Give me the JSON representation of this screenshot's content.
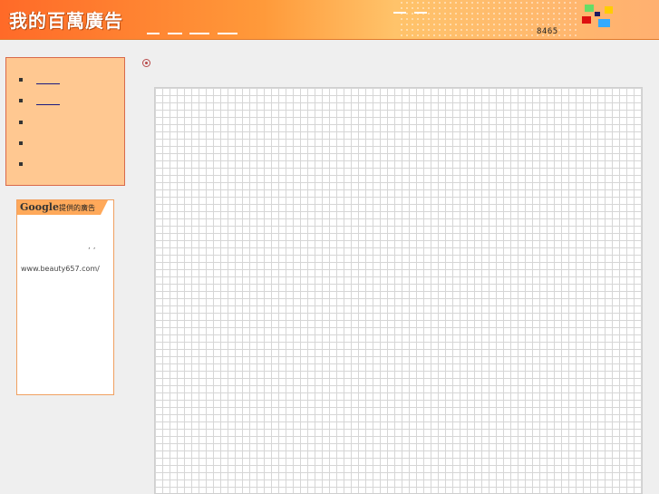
{
  "header": {
    "logo_text": "我的百萬廣告",
    "counter": "8465"
  },
  "colors": {
    "square_green": "#66dd66",
    "square_yellow": "#ffcc00",
    "square_navy": "#1a1a60",
    "square_red": "#dd1010",
    "square_blue": "#33aaff"
  },
  "sidebar": {
    "items": [
      {
        "label": ""
      },
      {
        "label": ""
      },
      {
        "label": ""
      },
      {
        "label": ""
      },
      {
        "label": ""
      }
    ]
  },
  "ad": {
    "brand": "Google",
    "label": "提供的廣告",
    "marks": ",  ,",
    "url": "www.beauty657.com/"
  },
  "main": {
    "grid_icon": "target-icon"
  }
}
